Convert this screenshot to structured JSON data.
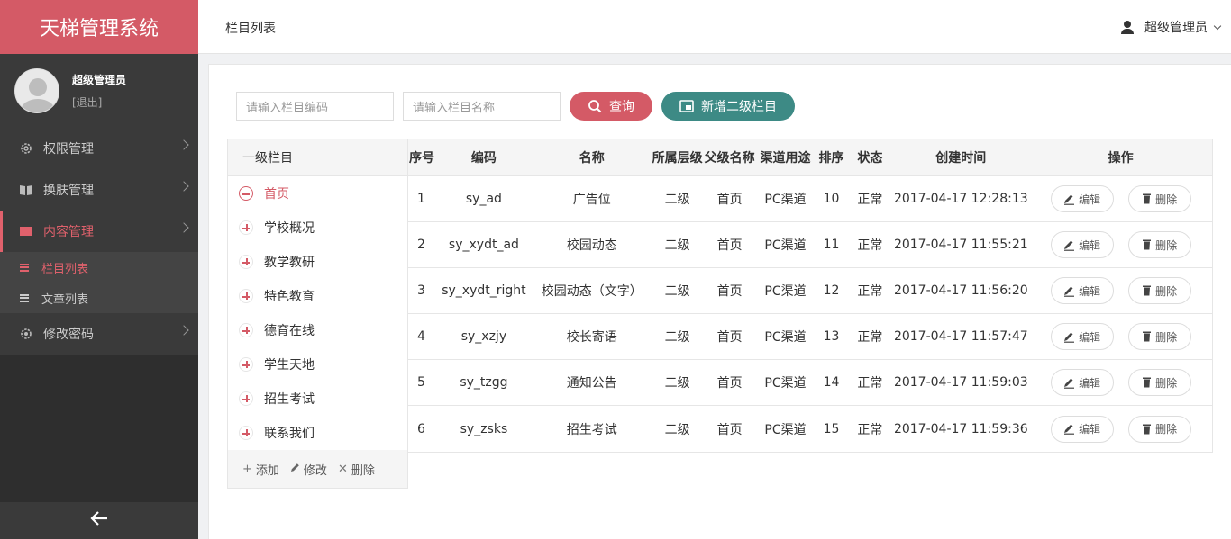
{
  "app": {
    "title": "天梯管理系统"
  },
  "user": {
    "name": "超级管理员",
    "logout": "[退出]"
  },
  "menu": [
    {
      "label": "权限管理",
      "icon": "gear-icon"
    },
    {
      "label": "换肤管理",
      "icon": "book-icon"
    },
    {
      "label": "内容管理",
      "icon": "folder-icon"
    },
    {
      "label": "修改密码",
      "icon": "gear-icon"
    }
  ],
  "submenu": [
    {
      "label": "栏目列表"
    },
    {
      "label": "文章列表"
    }
  ],
  "header": {
    "title": "栏目列表",
    "user": "超级管理员"
  },
  "search": {
    "code_placeholder": "请输入栏目编码",
    "name_placeholder": "请输入栏目名称",
    "query_label": "查询",
    "add_label": "新增二级栏目"
  },
  "tree": {
    "header": "一级栏目",
    "nodes": [
      "首页",
      "学校概况",
      "教学教研",
      "特色教育",
      "德育在线",
      "学生天地",
      "招生考试",
      "联系我们"
    ],
    "footer": {
      "add": "添加",
      "edit": "修改",
      "delete": "删除"
    }
  },
  "table": {
    "columns": [
      "序号",
      "编码",
      "名称",
      "所属层级",
      "父级名称",
      "渠道用途",
      "排序",
      "状态",
      "创建时间",
      "操作"
    ],
    "rows": [
      [
        "1",
        "sy_ad",
        "广告位",
        "二级",
        "首页",
        "PC渠道",
        "10",
        "正常",
        "2017-04-17 12:28:13"
      ],
      [
        "2",
        "sy_xydt_ad",
        "校园动态",
        "二级",
        "首页",
        "PC渠道",
        "11",
        "正常",
        "2017-04-17 11:55:21"
      ],
      [
        "3",
        "sy_xydt_right",
        "校园动态（文字）",
        "二级",
        "首页",
        "PC渠道",
        "12",
        "正常",
        "2017-04-17 11:56:20"
      ],
      [
        "4",
        "sy_xzjy",
        "校长寄语",
        "二级",
        "首页",
        "PC渠道",
        "13",
        "正常",
        "2017-04-17 11:57:47"
      ],
      [
        "5",
        "sy_tzgg",
        "通知公告",
        "二级",
        "首页",
        "PC渠道",
        "14",
        "正常",
        "2017-04-17 11:59:03"
      ],
      [
        "6",
        "sy_zsks",
        "招生考试",
        "二级",
        "首页",
        "PC渠道",
        "15",
        "正常",
        "2017-04-17 11:59:36"
      ]
    ],
    "edit_label": "编辑",
    "delete_label": "删除"
  },
  "colors": {
    "brand": "#d45a66",
    "accent_teal": "#3d8a85",
    "sidebar": "#2e2e2e"
  }
}
